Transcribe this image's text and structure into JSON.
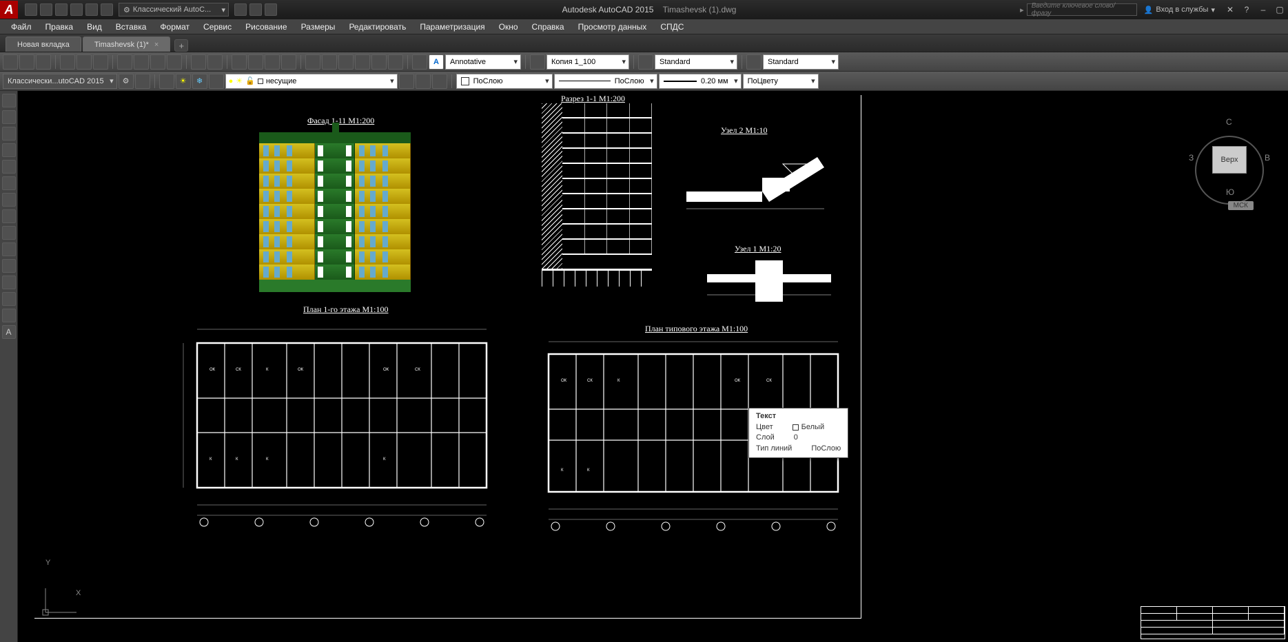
{
  "titlebar": {
    "workspace": "Классический AutoC...",
    "app": "Autodesk AutoCAD 2015",
    "doc": "Timashevsk (1).dwg",
    "search_placeholder": "Введите ключевое слово/фразу",
    "login": "Вход в службы"
  },
  "menu": [
    "Файл",
    "Правка",
    "Вид",
    "Вставка",
    "Формат",
    "Сервис",
    "Рисование",
    "Размеры",
    "Редактировать",
    "Параметризация",
    "Окно",
    "Справка",
    "Просмотр данных",
    "СПДС"
  ],
  "tabs": {
    "new": "Новая вкладка",
    "active": "Timashevsk (1)*"
  },
  "row1": {
    "anno_style": "Annotative",
    "dim_style": "Копия 1_100",
    "text_style": "Standard",
    "table_style": "Standard"
  },
  "row2": {
    "ws": "Классически...utoCAD 2015",
    "layer": "несущие",
    "ltype": "ПоСлою",
    "lweight_label": "ПоСлою",
    "lweight": "0.20 мм",
    "color": "ПоЦвету"
  },
  "drawing": {
    "facade": "Фасад 1-11 М1:200",
    "section": "Разрез 1-1 М1:200",
    "detail2": "Узел 2  М1:10",
    "detail1": "Узел 1  М1:20",
    "plan1": "План 1-го этажа М1:100",
    "plan_typ": "План типового этажа М1:100"
  },
  "tooltip": {
    "title": "Текст",
    "rows": [
      {
        "k": "Цвет",
        "v": "Белый"
      },
      {
        "k": "Слой",
        "v": "0"
      },
      {
        "k": "Тип линий",
        "v": "ПоСлою"
      }
    ]
  },
  "viewcube": {
    "top": "Верх",
    "n": "С",
    "s": "Ю",
    "e": "В",
    "w": "З",
    "wcs": "МСК"
  },
  "ucs": {
    "x": "X",
    "y": "Y"
  }
}
